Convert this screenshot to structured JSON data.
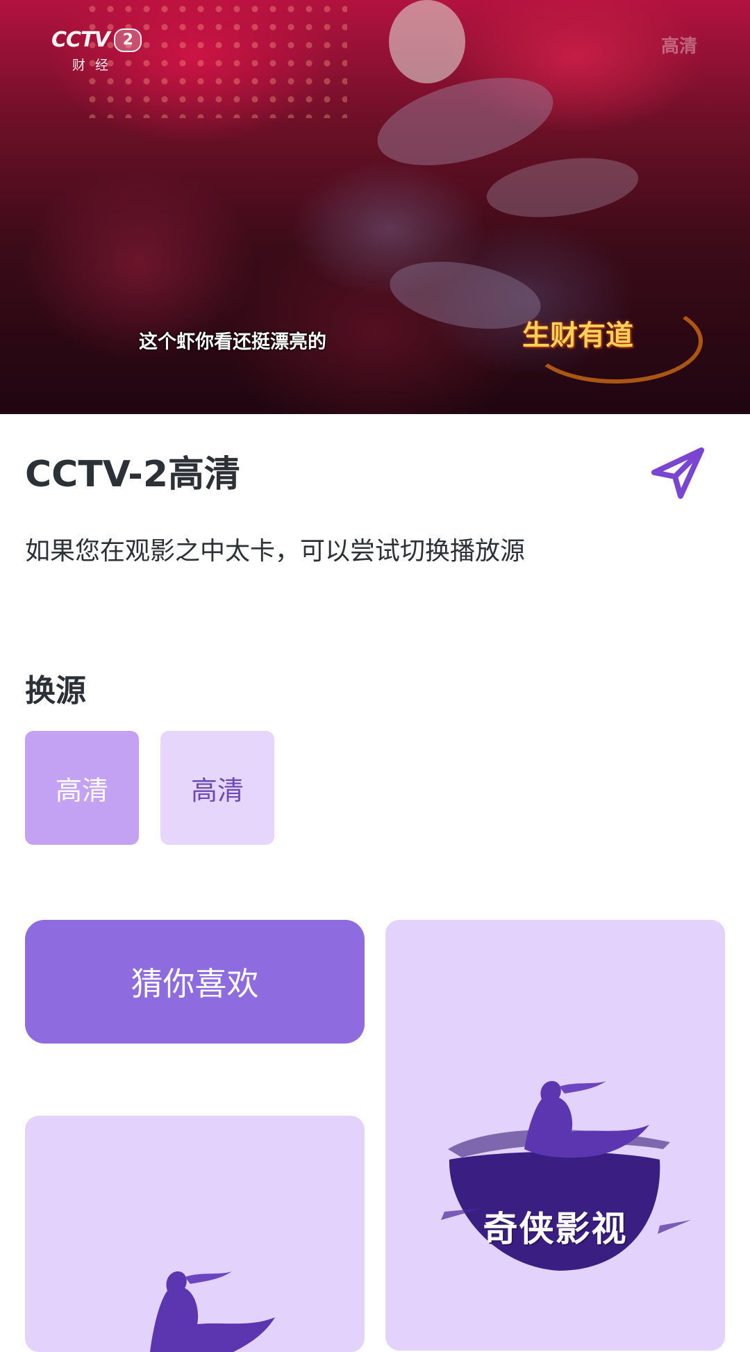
{
  "player": {
    "channel_logo_text": "CCTV",
    "channel_logo_number": "2",
    "channel_logo_sub": "财经",
    "quality_watermark": "高清",
    "subtitle": "这个虾你看还挺漂亮的",
    "show_logo_text": "生财有道"
  },
  "info": {
    "title": "CCTV-2高清",
    "hint": "如果您在观影之中太卡，可以尝试切换播放源"
  },
  "sources": {
    "section_title": "换源",
    "items": [
      {
        "label": "高清",
        "selected": true
      },
      {
        "label": "高清",
        "selected": false
      }
    ]
  },
  "recommend": {
    "guess_label": "猜你喜欢",
    "brand_name": "奇侠影视"
  },
  "colors": {
    "accent": "#8e6ce0",
    "source_selected": "#c3a2f4",
    "source_idle": "#e6d6fb",
    "card_bg": "#e3d2fb",
    "share_icon": "#7a45d0"
  }
}
